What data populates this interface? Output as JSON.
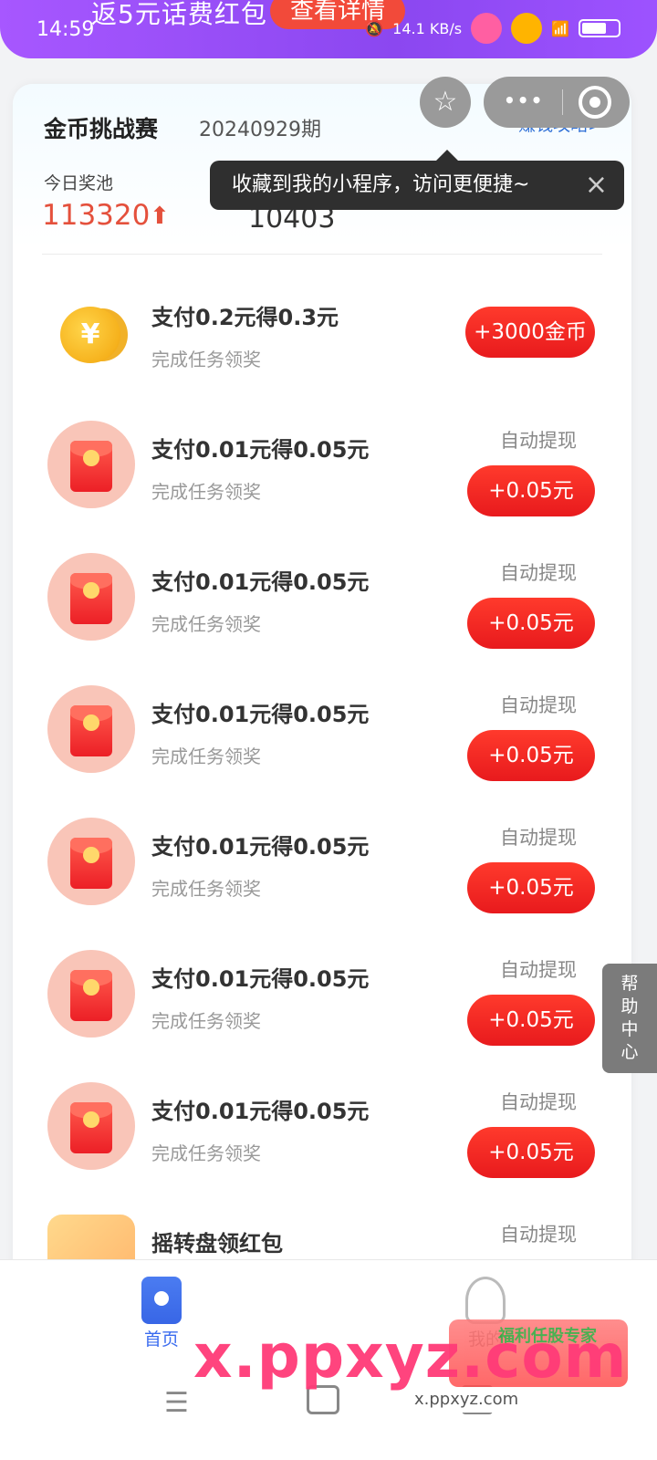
{
  "status_bar": {
    "time": "14:59",
    "network_speed": "14.1 KB/s"
  },
  "banner": {
    "text": "返5元话费红包",
    "button": "查看详情"
  },
  "capsule": {
    "more_icon": "more-dots-icon",
    "close_icon": "target-icon"
  },
  "favorite": {
    "icon": "star-icon"
  },
  "tooltip": {
    "text": "收藏到我的小程序，访问更便捷~",
    "close": "×"
  },
  "header": {
    "title": "金币挑战赛",
    "period": "20240929期",
    "guide_link": "赚钱攻略>",
    "pool_label": "今日奖池",
    "pool_value": "113320",
    "pool_arrow": "⬆",
    "count_value": "10403"
  },
  "tasks": [
    {
      "title": "支付0.2元得0.3元",
      "subtitle": "完成任务领奖",
      "auto": "",
      "reward": "+3000金币",
      "icon": "gold-coin-icon"
    },
    {
      "title": "支付0.01元得0.05元",
      "subtitle": "完成任务领奖",
      "auto": "自动提现",
      "reward": "+0.05元",
      "icon": "red-envelope-icon"
    },
    {
      "title": "支付0.01元得0.05元",
      "subtitle": "完成任务领奖",
      "auto": "自动提现",
      "reward": "+0.05元",
      "icon": "red-envelope-icon"
    },
    {
      "title": "支付0.01元得0.05元",
      "subtitle": "完成任务领奖",
      "auto": "自动提现",
      "reward": "+0.05元",
      "icon": "red-envelope-icon"
    },
    {
      "title": "支付0.01元得0.05元",
      "subtitle": "完成任务领奖",
      "auto": "自动提现",
      "reward": "+0.05元",
      "icon": "red-envelope-icon"
    },
    {
      "title": "支付0.01元得0.05元",
      "subtitle": "完成任务领奖",
      "auto": "自动提现",
      "reward": "+0.05元",
      "icon": "red-envelope-icon"
    },
    {
      "title": "支付0.01元得0.05元",
      "subtitle": "完成任务领奖",
      "auto": "自动提现",
      "reward": "+0.05元",
      "icon": "red-envelope-icon"
    },
    {
      "title": "摇转盘领红包",
      "subtitle": "",
      "auto": "自动提现",
      "reward": "",
      "icon": "lucky-wheel-icon"
    }
  ],
  "help": {
    "label": "帮助中心"
  },
  "tabbar": {
    "home": "首页",
    "mine": "我的"
  },
  "watermark": {
    "big": "x.ppxyz.com",
    "small": "x.ppxyz.com",
    "badge": "福利任股专家"
  },
  "colors": {
    "accent_red": "#e81a1d",
    "brand_blue": "#3b6cef",
    "banner_purple": "#a757ff"
  }
}
